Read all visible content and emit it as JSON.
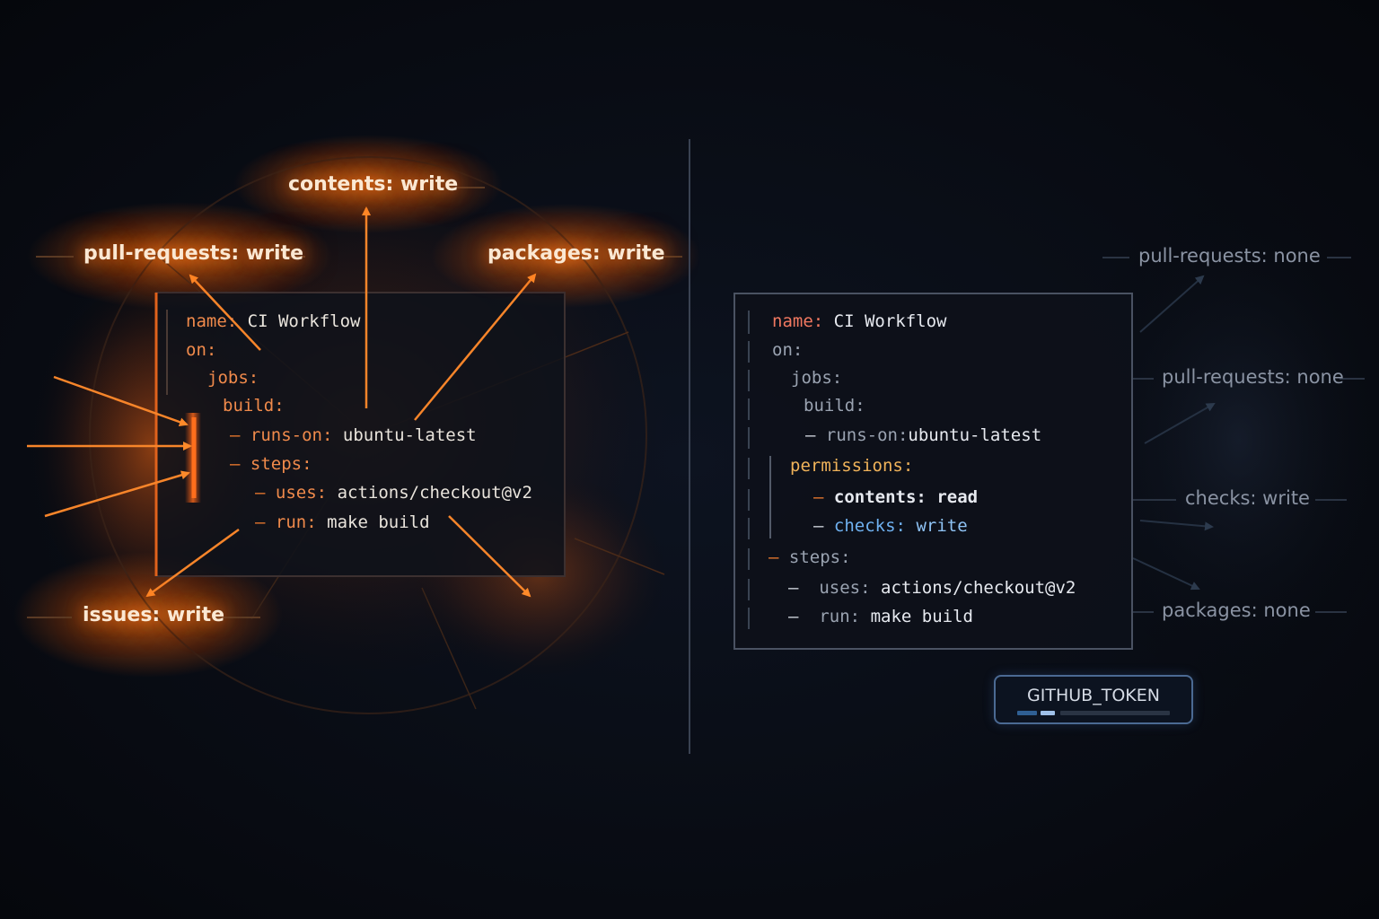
{
  "left": {
    "labels": {
      "contents": "contents: write",
      "pull_requests": "pull-requests: write",
      "packages": "packages: write",
      "issues": "issues: write"
    },
    "code": {
      "name_key": "name:",
      "name_val": "CI Workflow",
      "on_key": "on:",
      "jobs_key": "jobs:",
      "build_key": "build:",
      "runs_on_key": "runs-on:",
      "runs_on_val": "ubuntu-latest",
      "steps_key": "steps:",
      "uses_key": "uses:",
      "uses_val": "actions/checkout@v2",
      "run_key": "run:",
      "run_val": "make build",
      "dash": "–"
    }
  },
  "right": {
    "labels": {
      "pull_requests_1": "pull-requests: none",
      "pull_requests_2": "pull-requests: none",
      "checks": "checks: write",
      "packages": "packages: none"
    },
    "code": {
      "name_key": "name:",
      "name_val": "CI Workflow",
      "on_key": "on:",
      "jobs_key": "jobs:",
      "build_key": "build:",
      "runs_on_key": "runs-on:",
      "runs_on_val": "ubuntu-latest",
      "permissions_key": "permissions:",
      "contents_key": "contents:",
      "contents_val": "read",
      "checks_key": "checks:",
      "checks_val": "write",
      "steps_key": "steps:",
      "uses_key": "uses:",
      "uses_val": "actions/checkout@v2",
      "run_key": "run:",
      "run_val": "make build",
      "dash": "–"
    },
    "token": {
      "label": "GITHUB_TOKEN"
    }
  },
  "colors": {
    "warm_accent": "#f07b2e",
    "cool_border": "#4b6a93",
    "background": "#080b12"
  }
}
